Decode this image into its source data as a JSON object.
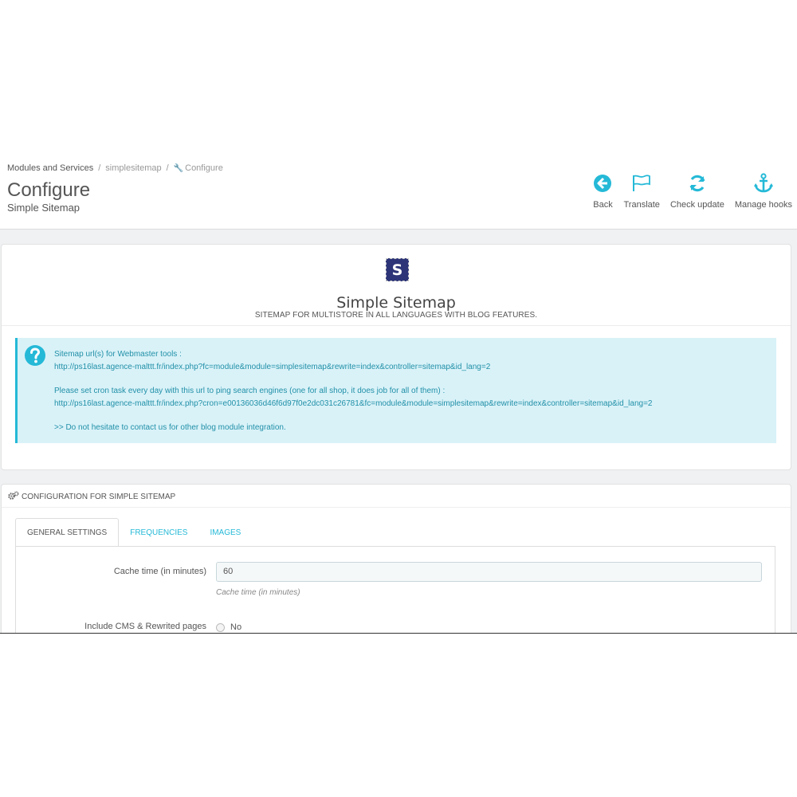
{
  "breadcrumb": {
    "items": [
      "Modules and Services",
      "simplesitemap",
      "Configure"
    ],
    "separator": "/"
  },
  "page": {
    "title": "Configure",
    "subtitle": "Simple Sitemap"
  },
  "toolbar": {
    "back": "Back",
    "translate": "Translate",
    "check_update": "Check update",
    "manage_hooks": "Manage hooks"
  },
  "module": {
    "logo_letter": "S",
    "name": "Simple Sitemap",
    "description": "SITEMAP FOR MULTISTORE IN ALL LANGUAGES WITH BLOG FEATURES."
  },
  "info": {
    "line1": "Sitemap url(s) for Webmaster tools :",
    "line2": "http://ps16last.agence-malttt.fr/index.php?fc=module&module=simplesitemap&rewrite=index&controller=sitemap&id_lang=2",
    "line3": "Please set cron task every day with this url to ping search engines (one for all shop, it does job for all of them) :",
    "line4": "http://ps16last.agence-malttt.fr/index.php?cron=e00136036d46f6d97f0e2dc031c26781&fc=module&module=simplesitemap&rewrite=index&controller=sitemap&id_lang=2",
    "line5": ">> Do not hesitate to contact us for other blog module integration."
  },
  "config": {
    "heading": "CONFIGURATION FOR SIMPLE SITEMAP",
    "tabs": [
      "GENERAL SETTINGS",
      "FREQUENCIES",
      "IMAGES"
    ],
    "cache_label": "Cache time (in minutes)",
    "cache_value": "60",
    "cache_help": "Cache time (in minutes)",
    "cms_label": "Include CMS & Rewrited pages",
    "cms_option": "No"
  },
  "colors": {
    "accent": "#25b9d7",
    "info_bg": "#d9f2f8",
    "logo_bg": "#2d3578"
  },
  "icons": [
    "back-icon",
    "flag-icon",
    "refresh-icon",
    "anchor-icon",
    "question-icon",
    "gears-icon",
    "wrench-icon"
  ]
}
